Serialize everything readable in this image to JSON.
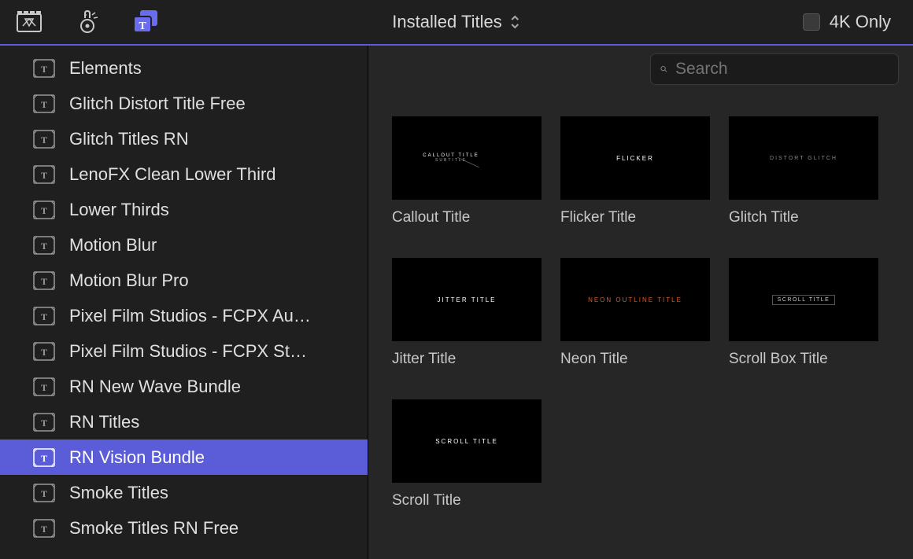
{
  "topbar": {
    "dropdown_label": "Installed Titles",
    "filter_label": "4K Only"
  },
  "search": {
    "placeholder": "Search",
    "value": ""
  },
  "sidebar": {
    "items": [
      {
        "label": "Elements",
        "selected": false
      },
      {
        "label": "Glitch Distort Title Free",
        "selected": false
      },
      {
        "label": "Glitch Titles RN",
        "selected": false
      },
      {
        "label": "LenoFX Clean Lower Third",
        "selected": false
      },
      {
        "label": "Lower Thirds",
        "selected": false
      },
      {
        "label": "Motion Blur",
        "selected": false
      },
      {
        "label": "Motion Blur Pro",
        "selected": false
      },
      {
        "label": "Pixel Film Studios - FCPX Au…",
        "selected": false
      },
      {
        "label": "Pixel Film Studios - FCPX St…",
        "selected": false
      },
      {
        "label": "RN New Wave Bundle",
        "selected": false
      },
      {
        "label": "RN Titles",
        "selected": false
      },
      {
        "label": "RN Vision Bundle",
        "selected": true
      },
      {
        "label": "Smoke Titles",
        "selected": false
      },
      {
        "label": "Smoke Titles RN Free",
        "selected": false
      }
    ]
  },
  "tiles": [
    {
      "label": "Callout Title",
      "thumb_main": "CALLOUT TITLE",
      "thumb_sub": "SUBTITLE",
      "style": "callout"
    },
    {
      "label": "Flicker Title",
      "thumb_main": "FLICKER",
      "style": "plain"
    },
    {
      "label": "Glitch Title",
      "thumb_main": "DISTORT GLITCH",
      "style": "gray"
    },
    {
      "label": "Jitter Title",
      "thumb_main": "JITTER TITLE",
      "style": "plain"
    },
    {
      "label": "Neon Title",
      "thumb_main": "NEON OUTLINE TITLE",
      "style": "orange"
    },
    {
      "label": "Scroll Box Title",
      "thumb_main": "SCROLL TITLE",
      "style": "box"
    },
    {
      "label": "Scroll Title",
      "thumb_main": "SCROLL TITLE",
      "style": "plain"
    }
  ]
}
